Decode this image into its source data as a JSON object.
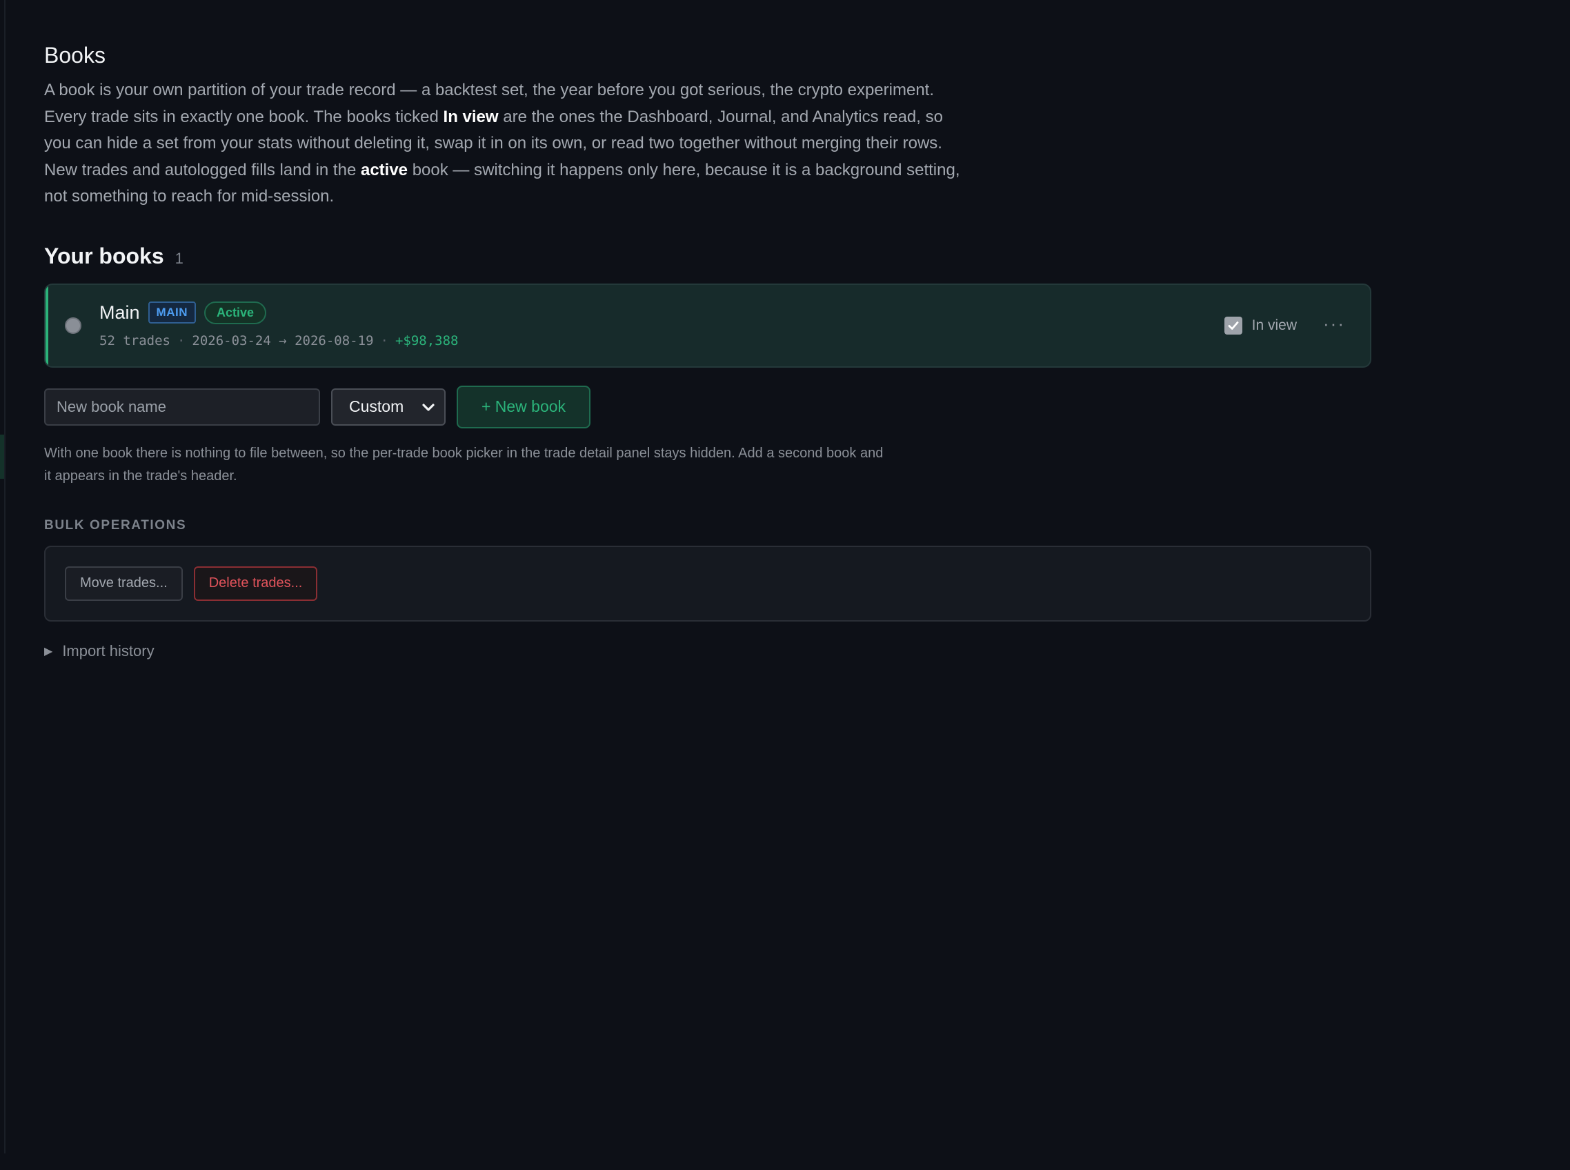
{
  "page": {
    "title": "Books",
    "intro_parts": {
      "p1": "A book is your own partition of your trade record — a backtest set, the year before you got serious, the crypto experiment. Every trade sits in exactly one book. The books ticked ",
      "b1": "In view",
      "p2": " are the ones the Dashboard, Journal, and Analytics read, so you can hide a set from your stats without deleting it, swap it in on its own, or read two together without merging their rows. New trades and autologged fills land in the ",
      "b2": "active",
      "p3": " book — switching it happens only here, because it is a background setting, not something to reach for mid-session."
    }
  },
  "books_section": {
    "heading": "Your books",
    "count": "1"
  },
  "books": [
    {
      "name": "Main",
      "tag_main": "MAIN",
      "tag_active": "Active",
      "trades": "52 trades",
      "range": "2026-03-24 → 2026-08-19",
      "pnl": "+$98,388",
      "separator": "·",
      "inview_label": "In view",
      "inview_checked": true,
      "more_label": "···"
    }
  ],
  "create": {
    "name_placeholder": "New book name",
    "template_selected": "Custom",
    "new_button_label": "+ New book"
  },
  "hint": "With one book there is nothing to file between, so the per-trade book picker in the trade detail panel stays hidden. Add a second book and it appears in the trade's header.",
  "bulk": {
    "label": "BULK OPERATIONS",
    "move_label": "Move trades...",
    "delete_label": "Delete trades..."
  },
  "import_history": {
    "label": "Import history",
    "expanded": false
  },
  "colors": {
    "background": "#0d1017",
    "accent_green": "#2bb37a",
    "tag_blue": "#4d9cf0",
    "danger_red": "#e0535b"
  },
  "icons": {
    "disclosure": "triangle-right-icon",
    "select_chevron": "chevron-down-icon",
    "checkbox": "check-icon",
    "more": "ellipsis-icon"
  }
}
